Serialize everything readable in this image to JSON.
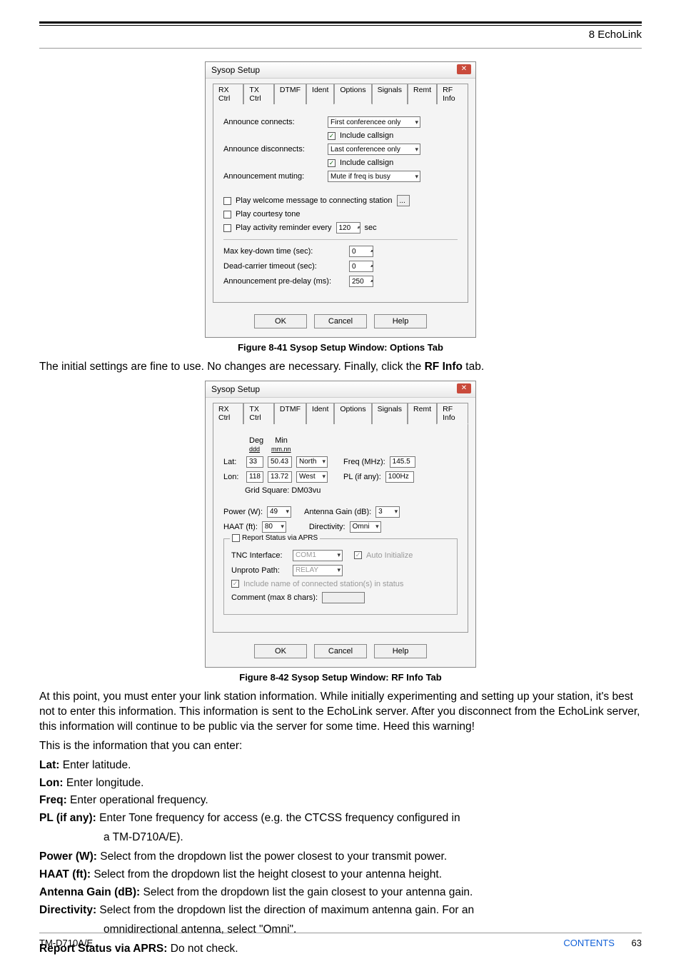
{
  "header": {
    "chapter": "8 EchoLink"
  },
  "dialog1": {
    "title": "Sysop Setup",
    "tabs": [
      "RX Ctrl",
      "TX Ctrl",
      "DTMF",
      "Ident",
      "Options",
      "Signals",
      "Remt",
      "RF Info"
    ],
    "active_tab": "Options",
    "announce_connects_label": "Announce connects:",
    "announce_connects_value": "First conferencee only",
    "include_callsign_1": "Include callsign",
    "announce_disconnects_label": "Announce disconnects:",
    "announce_disconnects_value": "Last conferencee only",
    "include_callsign_2": "Include callsign",
    "announcement_muting_label": "Announcement muting:",
    "announcement_muting_value": "Mute if freq is busy",
    "play_welcome": "Play welcome message to connecting station",
    "play_courtesy": "Play courtesy tone",
    "play_activity": "Play activity reminder every",
    "play_activity_sec": "120",
    "sec": "sec",
    "max_keydown": "Max key-down time (sec):",
    "max_keydown_val": "0",
    "dead_carrier": "Dead-carrier timeout (sec):",
    "dead_carrier_val": "0",
    "announce_predelay": "Announcement pre-delay (ms):",
    "announce_predelay_val": "250",
    "ok": "OK",
    "cancel": "Cancel",
    "help": "Help"
  },
  "caption1": "Figure 8-41   Sysop Setup Window: Options Tab",
  "para1_a": "The initial settings are fine to use.  No changes are necessary.  Finally, click the ",
  "para1_b": "RF Info",
  "para1_c": " tab.",
  "dialog2": {
    "title": "Sysop Setup",
    "tabs": [
      "RX Ctrl",
      "TX Ctrl",
      "DTMF",
      "Ident",
      "Options",
      "Signals",
      "Remt",
      "RF Info"
    ],
    "active_tab": "RF Info",
    "deg": "Deg",
    "min": "Min",
    "ddd": "ddd",
    "mmnn": "mm.nn",
    "lat": "Lat:",
    "lat_deg": "33",
    "lat_min": "50.43",
    "lat_dir": "North",
    "lon": "Lon:",
    "lon_deg": "118",
    "lon_min": "13.72",
    "lon_dir": "West",
    "grid": "Grid Square: DM03vu",
    "freq_label": "Freq (MHz):",
    "freq_val": "145.5",
    "pl_label": "PL (if any):",
    "pl_val": "100Hz",
    "power_label": "Power (W):",
    "power_val": "49",
    "gain_label": "Antenna Gain (dB):",
    "gain_val": "3",
    "haat_label": "HAAT (ft):",
    "haat_val": "80",
    "dir_label": "Directivity:",
    "dir_val": "Omni",
    "report_status": "Report Status via APRS",
    "tnc_label": "TNC Interface:",
    "tnc_val": "COM1",
    "auto_init": "Auto Initialize",
    "unproto_label": "Unproto Path:",
    "unproto_val": "RELAY",
    "include_name": "Include name of connected station(s) in status",
    "comment_label": "Comment (max 8 chars):",
    "ok": "OK",
    "cancel": "Cancel",
    "help": "Help"
  },
  "caption2": "Figure 8-42   Sysop Setup Window: RF Info Tab",
  "para2": "At this point, you must enter your link station information.  While initially experimenting and setting up your station, it's best not to enter this information.  This information is sent to the EchoLink server.  After you disconnect from the EchoLink server, this information will continue to be public via the server for some time.  Heed this warning!",
  "para3": "This is the information that you can enter:",
  "def_lat_l": "Lat:",
  "def_lat_t": " Enter latitude.",
  "def_lon_l": "Lon:",
  "def_lon_t": " Enter longitude.",
  "def_freq_l": "Freq:",
  "def_freq_t": " Enter operational frequency.",
  "def_pl_l": "PL (if any):",
  "def_pl_t1": " Enter Tone frequency for access (e.g. the CTCSS frequency configured in",
  "def_pl_t2": "a TM-D710A/E).",
  "def_pw_l": "Power (W):",
  "def_pw_t": " Select from the dropdown list the power closest to your transmit power.",
  "def_haat_l": "HAAT (ft):",
  "def_haat_t": " Select from the dropdown list the height closest to your antenna height.",
  "def_gain_l": "Antenna Gain (dB):",
  "def_gain_t": " Select from the dropdown list the gain closest to your antenna gain.",
  "def_dir_l": "Directivity:",
  "def_dir_t1": " Select from the dropdown list the direction of maximum antenna gain.  For an",
  "def_dir_t2": "omnidirectional antenna, select \"Omni\".",
  "def_rep_l": "Report Status via APRS:",
  "def_rep_t": " Do not check.",
  "footer": {
    "model": "TM-D710A/E",
    "contents": "CONTENTS",
    "page": "63"
  }
}
